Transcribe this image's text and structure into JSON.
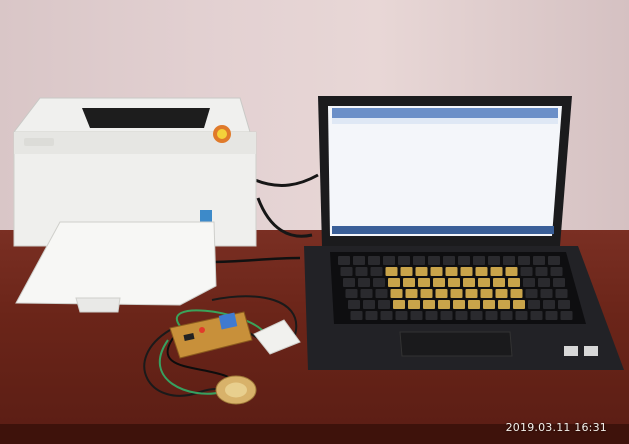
{
  "photo": {
    "timestamp": "2019.03.11 16:31"
  },
  "objects": [
    {
      "name": "printer",
      "icon": "printer-icon"
    },
    {
      "name": "laptop",
      "icon": "laptop-icon"
    },
    {
      "name": "circuit-board",
      "icon": "circuit-board-icon"
    },
    {
      "name": "piezo-sensor",
      "icon": "piezo-sensor-icon"
    },
    {
      "name": "small-module",
      "icon": "module-icon"
    }
  ],
  "colors": {
    "wall": "#e3d1d2",
    "table": "#6b2519",
    "printer": "#f2f2f0",
    "laptop": "#1b1b1d",
    "screen": "#f4f6fa",
    "board": "#c8903a"
  }
}
